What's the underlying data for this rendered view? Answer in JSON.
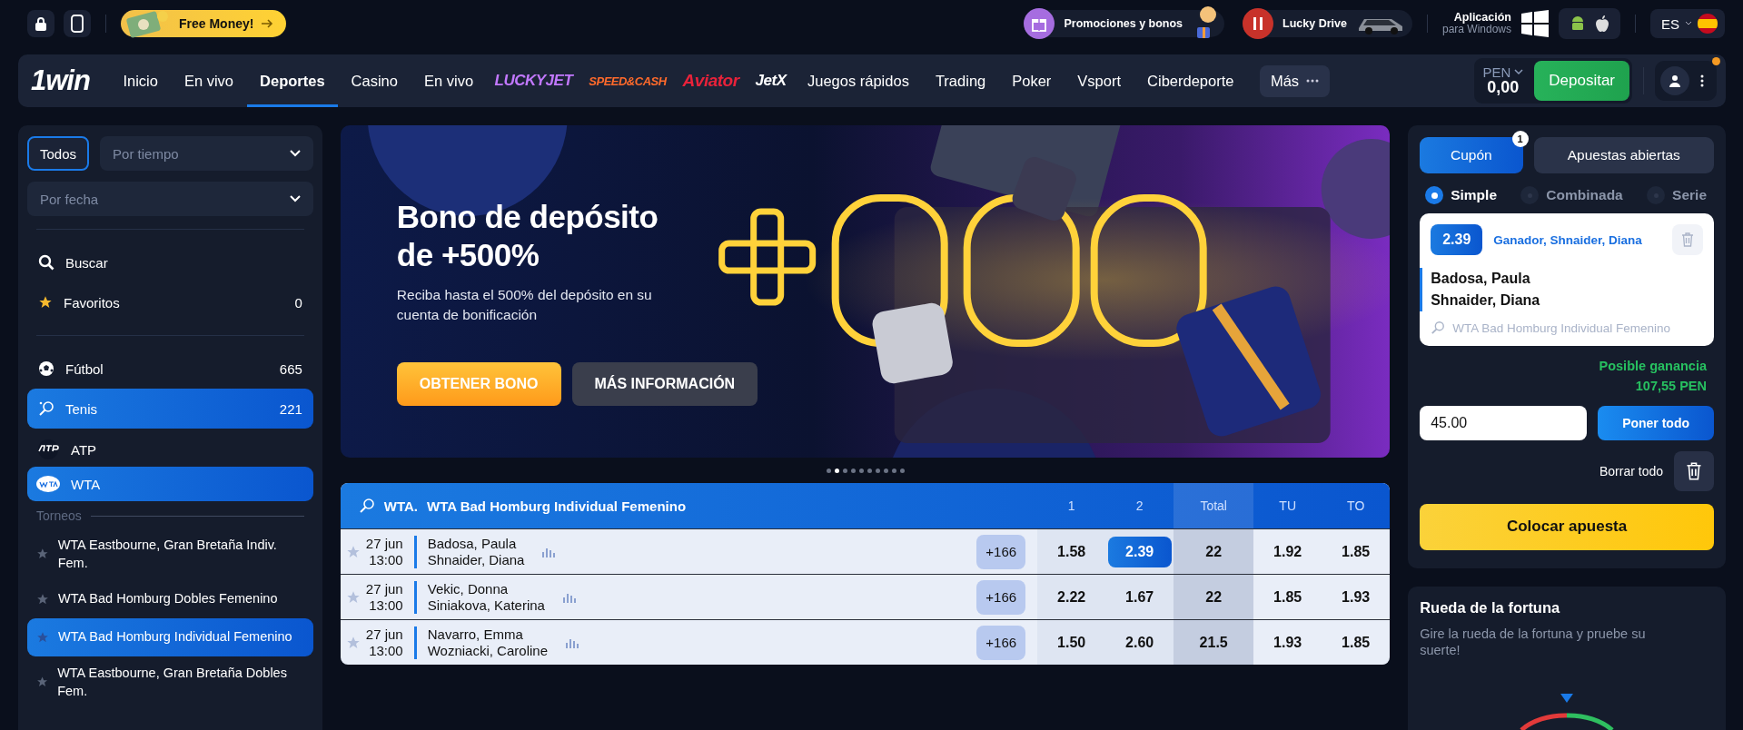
{
  "top_bar": {
    "free_money": "Free Money!",
    "promos": [
      {
        "kind": "gift",
        "label": "Promociones y bonos"
      },
      {
        "kind": "drive",
        "label": "Lucky Drive"
      }
    ],
    "app": {
      "title": "Aplicación",
      "subtitle": "para Windows"
    },
    "language": "ES"
  },
  "nav": {
    "logo": "1win",
    "items": [
      {
        "label": "Inicio",
        "kind": "text",
        "selected": false
      },
      {
        "label": "En vivo",
        "kind": "text",
        "selected": false
      },
      {
        "label": "Deportes",
        "kind": "text",
        "selected": true
      },
      {
        "label": "Casino",
        "kind": "text",
        "selected": false
      },
      {
        "label": "En vivo",
        "kind": "text",
        "selected": false
      },
      {
        "label": "LUCKYJET",
        "kind": "luckyjet",
        "selected": false
      },
      {
        "label": "SPEED&CASH",
        "kind": "speedcash",
        "selected": false
      },
      {
        "label": "Aviator",
        "kind": "aviator",
        "selected": false
      },
      {
        "label": "JetX",
        "kind": "jetx",
        "selected": false
      },
      {
        "label": "Juegos rápidos",
        "kind": "text",
        "selected": false
      },
      {
        "label": "Trading",
        "kind": "text",
        "selected": false
      },
      {
        "label": "Poker",
        "kind": "text",
        "selected": false
      },
      {
        "label": "Vsport",
        "kind": "text",
        "selected": false
      },
      {
        "label": "Ciberdeporte",
        "kind": "text",
        "selected": false
      }
    ],
    "more": "Más",
    "currency": "PEN",
    "balance": "0,00",
    "deposit": "Depositar",
    "notification": true
  },
  "sidebar": {
    "all_filter": {
      "label": "Todos",
      "selected": true
    },
    "time_select": {
      "placeholder": "Por tiempo"
    },
    "date_select": {
      "placeholder": "Por fecha"
    },
    "search": "Buscar",
    "favorites": {
      "label": "Favoritos",
      "count": "0"
    },
    "sports": [
      {
        "kind": "football",
        "name": "Fútbol",
        "count": "665",
        "selected": false
      },
      {
        "kind": "tennis",
        "name": "Tenis",
        "count": "221",
        "selected": true
      }
    ],
    "categories": [
      {
        "kind": "atp",
        "name": "ATP",
        "selected": false
      },
      {
        "kind": "wta",
        "name": "WTA",
        "selected": true
      }
    ],
    "section": "Torneos",
    "tournaments": [
      {
        "name": "WTA Eastbourne, Gran Bretaña Indiv. Fem.",
        "selected": false
      },
      {
        "name": "WTA Bad Homburg Dobles Femenino",
        "selected": false
      },
      {
        "name": "WTA Bad Homburg Individual Femenino",
        "selected": true
      },
      {
        "name": "WTA Eastbourne, Gran Bretaña Dobles Fem.",
        "selected": false
      }
    ]
  },
  "banner": {
    "title": "Bono de depósito de +500%",
    "text": "Reciba hasta el 500% del depósito en su cuenta de bonificación",
    "primary": "OBTENER BONO",
    "secondary": "MÁS INFORMACIÓN",
    "slides": [
      {
        "selected": false
      },
      {
        "selected": true
      },
      {
        "selected": false
      },
      {
        "selected": false
      },
      {
        "selected": false
      },
      {
        "selected": false
      },
      {
        "selected": false
      },
      {
        "selected": false
      },
      {
        "selected": false
      },
      {
        "selected": false
      }
    ]
  },
  "matches": {
    "sport": "WTA.",
    "league": "WTA Bad Homburg Individual Femenino",
    "columns": [
      "1",
      "2",
      "Total",
      "TU",
      "TO"
    ],
    "rows": [
      {
        "date": "27 jun",
        "time": "13:00",
        "team1": "Badosa, Paula",
        "team2": "Shnaider, Diana",
        "more": "+166",
        "odds": [
          {
            "value": "1.58",
            "selected": false
          },
          {
            "value": "2.39",
            "selected": true
          },
          {
            "value": "22",
            "selected": false
          },
          {
            "value": "1.92",
            "selected": false
          },
          {
            "value": "1.85",
            "selected": false
          }
        ]
      },
      {
        "date": "27 jun",
        "time": "13:00",
        "team1": "Vekic, Donna",
        "team2": "Siniakova, Katerina",
        "more": "+166",
        "odds": [
          {
            "value": "2.22",
            "selected": false
          },
          {
            "value": "1.67",
            "selected": false
          },
          {
            "value": "22",
            "selected": false
          },
          {
            "value": "1.85",
            "selected": false
          },
          {
            "value": "1.93",
            "selected": false
          }
        ]
      },
      {
        "date": "27 jun",
        "time": "13:00",
        "team1": "Navarro, Emma",
        "team2": "Wozniacki, Caroline",
        "more": "+166",
        "odds": [
          {
            "value": "1.50",
            "selected": false
          },
          {
            "value": "2.60",
            "selected": false
          },
          {
            "value": "21.5",
            "selected": false
          },
          {
            "value": "1.93",
            "selected": false
          },
          {
            "value": "1.85",
            "selected": false
          }
        ]
      }
    ]
  },
  "betslip": {
    "tabs": [
      {
        "label": "Cupón",
        "selected": true,
        "badge": "1"
      },
      {
        "label": "Apuestas abiertas",
        "selected": false
      }
    ],
    "types": [
      {
        "label": "Simple",
        "selected": true
      },
      {
        "label": "Combinada",
        "selected": false
      },
      {
        "label": "Serie",
        "selected": false
      }
    ],
    "bet": {
      "odd": "2.39",
      "market": "Ganador, Shnaider, Diana",
      "team1": "Badosa, Paula",
      "team2": "Shnaider, Diana",
      "league": "WTA Bad Homburg Individual Femenino"
    },
    "win_label": "Posible ganancia",
    "win_amount": "107,55 PEN",
    "stake": "45.00",
    "all_in": "Poner todo",
    "clear": "Borrar todo",
    "place": "Colocar apuesta"
  },
  "wheel": {
    "title": "Rueda de la fortuna",
    "text": "Gire la rueda de la fortuna y pruebe su suerte!"
  }
}
